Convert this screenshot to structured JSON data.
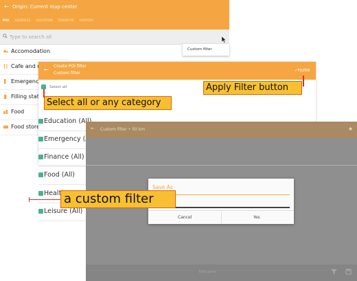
{
  "screen1": {
    "title": "Origin: Current map center",
    "tabs": [
      "POI",
      "ADDRESS",
      "LOCATION",
      "FAVORITE",
      "HISTORY"
    ],
    "search_placeholder": "Type to search all",
    "dropdown_item": "Custom filter",
    "categories": [
      {
        "label": "Accomodation",
        "icon": "bed-icon"
      },
      {
        "label": "Cafe and restaurant",
        "icon": "fork-knife-icon"
      },
      {
        "label": "Emergency",
        "icon": "emergency-icon"
      },
      {
        "label": "Filling station",
        "icon": "fuel-icon"
      },
      {
        "label": "Food",
        "icon": "food-icon"
      },
      {
        "label": "Food store",
        "icon": "store-icon"
      }
    ]
  },
  "screen2": {
    "title_line1": "Create POI filter",
    "title_line2": "Custom filter",
    "filter_button": "FILTER",
    "select_all": "Select all",
    "categories": [
      "Education (All)",
      "Emergency (All)",
      "Finance (All)",
      "Food (All)",
      "Health",
      "Leisure (All)"
    ]
  },
  "screen3": {
    "title": "Custom filter • 50 km",
    "bottom_label": "Edit quick",
    "dialog": {
      "title": "Save As",
      "cancel": "Cancel",
      "yes": "Yes"
    }
  },
  "annotations": {
    "select_all": "Select all or any category",
    "apply_filter": "Apply Filter button",
    "custom_filter": "a custom filter"
  },
  "colors": {
    "accent": "#f5a642",
    "checkbox": "#4caf8f",
    "annotation_bg": "#f7c033",
    "annotation_border": "#e0600a"
  }
}
